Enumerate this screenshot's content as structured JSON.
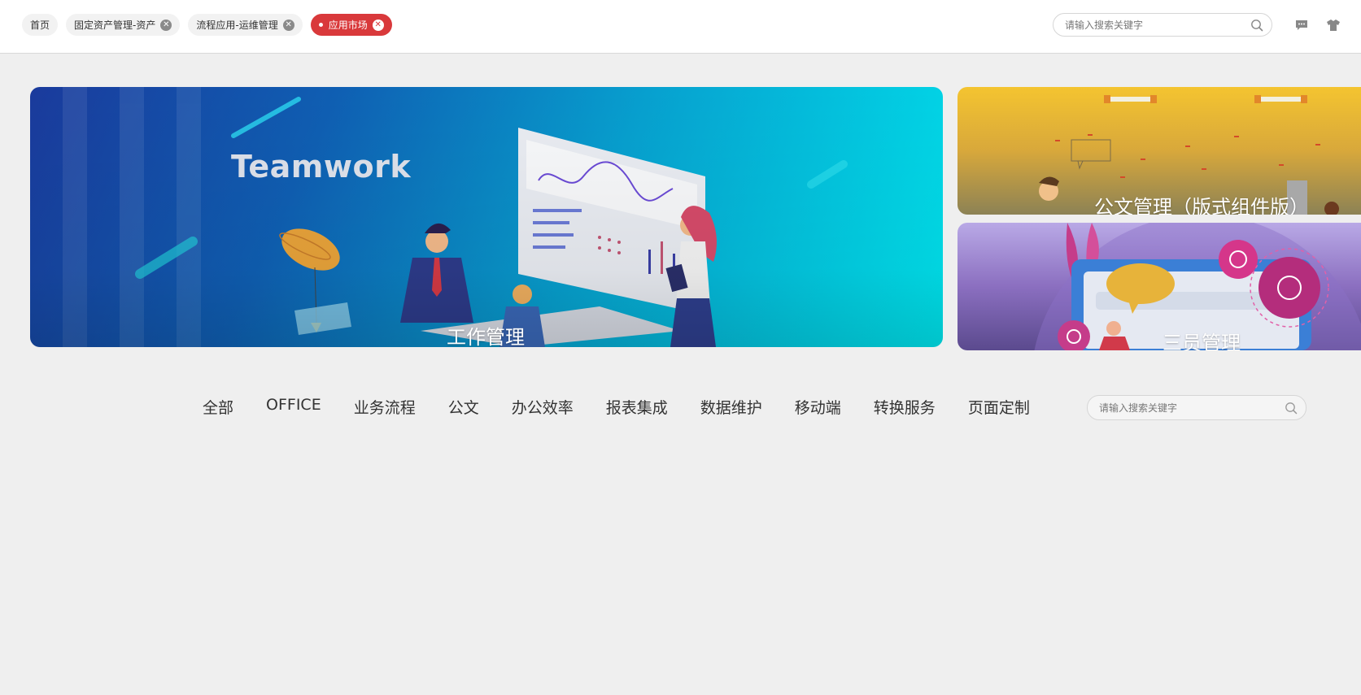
{
  "tabs": [
    {
      "label": "首页",
      "closable": false,
      "active": false
    },
    {
      "label": "固定资产管理-资产",
      "closable": true,
      "active": false
    },
    {
      "label": "流程应用-运维管理",
      "closable": true,
      "active": false
    },
    {
      "label": "应用市场",
      "closable": true,
      "active": true
    }
  ],
  "header": {
    "search_placeholder": "请输入搜索关键字",
    "icons": [
      "message-icon",
      "shirt-icon"
    ]
  },
  "banners": {
    "main": {
      "title": "工作管理",
      "art_text": "Teamwork"
    },
    "right_top": {
      "title": "公文管理（版式组件版）"
    },
    "right_bottom": {
      "title": "三员管理"
    }
  },
  "categories": [
    "全部",
    "OFFICE",
    "业务流程",
    "公文",
    "办公效率",
    "报表集成",
    "数据维护",
    "移动端",
    "转换服务",
    "页面定制"
  ],
  "category_search": {
    "placeholder": "请输入搜索关键字"
  },
  "colors": {
    "accent": "#d9393b",
    "background": "#efefef"
  }
}
